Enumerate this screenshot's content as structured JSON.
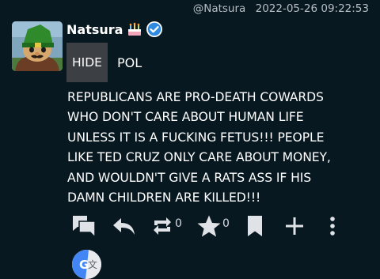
{
  "post": {
    "handle": "@Natsura",
    "timestamp": "2022-05-26 09:22:53",
    "display_name": "Natsura",
    "content_warning": {
      "toggle_label": "HIDE",
      "subject": "POL"
    },
    "body_lines": [
      "REPUBLICANS ARE PRO-DEATH COWARDS",
      "WHO DON'T CARE ABOUT HUMAN LIFE",
      "UNLESS IT IS A FUCKING FETUS!!! PEOPLE",
      "LIKE TED CRUZ ONLY CARE ABOUT MONEY,",
      "AND WOULDN'T GIVE A RATS ASS IF HIS",
      "DAMN CHILDREN ARE KILLED!!!"
    ]
  },
  "actions": {
    "reply_thread_icon": "conversation-icon",
    "reply_icon": "reply-icon",
    "boost_icon": "repeat-icon",
    "boost_count": "0",
    "favourite_icon": "star-icon",
    "favourite_count": "0",
    "bookmark_icon": "bookmark-icon",
    "more_actions_icon": "plus-icon",
    "overflow_icon": "vertical-dots-icon"
  },
  "translate": {
    "icon": "google-translate-icon",
    "glyph_left": "G",
    "glyph_right": "文"
  },
  "colors": {
    "background": "#081821",
    "text": "#ffffff",
    "meta_text": "#b6bec4",
    "verified_badge": "#2f8ae0",
    "hide_button_bg": "#3c3f44",
    "action_icons": "#dfe3e7",
    "translate_blue": "#4285f4"
  }
}
